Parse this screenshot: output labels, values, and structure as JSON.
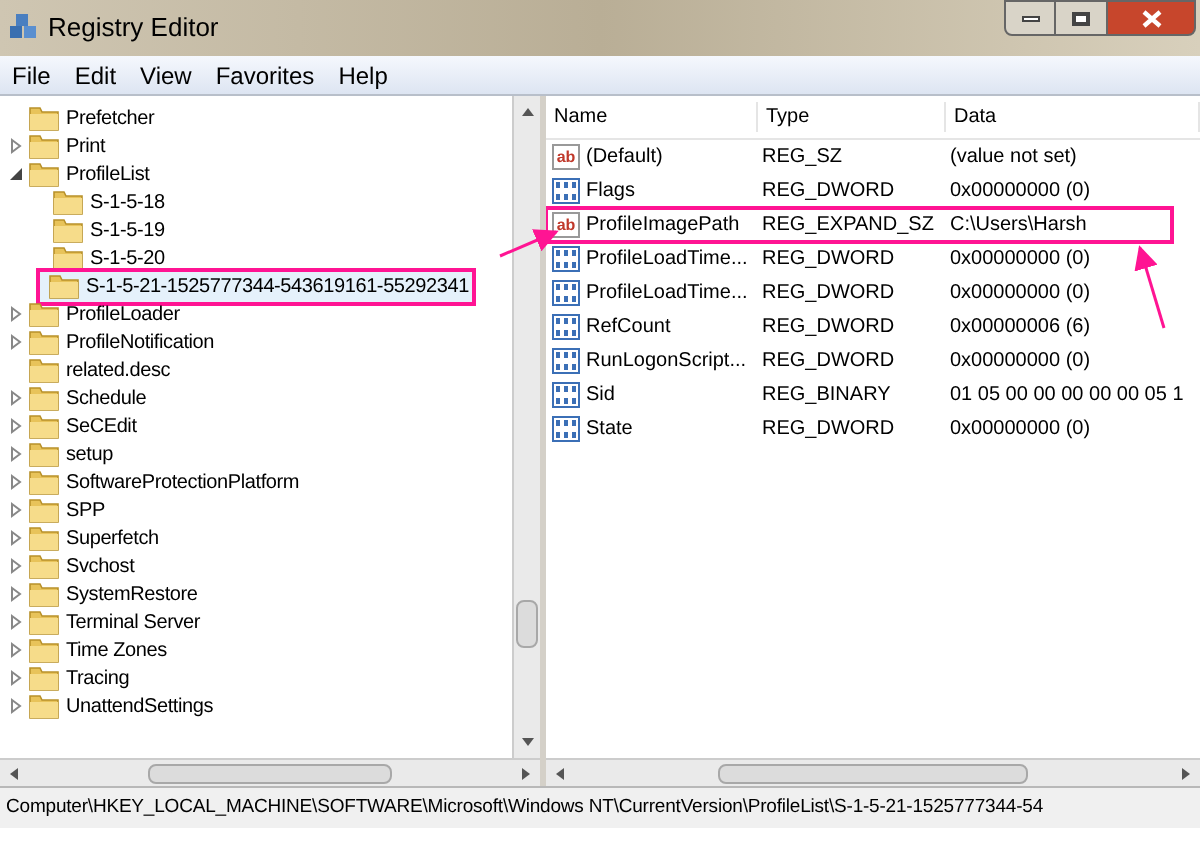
{
  "window": {
    "title": "Registry Editor"
  },
  "menu": [
    "File",
    "Edit",
    "View",
    "Favorites",
    "Help"
  ],
  "tree": [
    {
      "label": "Prefetcher",
      "selected": false
    },
    {
      "label": "Print",
      "expanded": false,
      "selected": false
    },
    {
      "label": "ProfileList",
      "expanded": true,
      "selected": false,
      "children": [
        {
          "label": "S-1-5-18",
          "selected": false
        },
        {
          "label": "S-1-5-19",
          "selected": false
        },
        {
          "label": "S-1-5-20",
          "selected": false
        },
        {
          "label": "S-1-5-21-1525777344-543619161-55292341",
          "selected": true
        }
      ]
    },
    {
      "label": "ProfileLoader",
      "expanded": false,
      "selected": false
    },
    {
      "label": "ProfileNotification",
      "expanded": false,
      "selected": false
    },
    {
      "label": "related.desc",
      "selected": false
    },
    {
      "label": "Schedule",
      "expanded": false,
      "selected": false
    },
    {
      "label": "SeCEdit",
      "expanded": false,
      "selected": false
    },
    {
      "label": "setup",
      "expanded": false,
      "selected": false
    },
    {
      "label": "SoftwareProtectionPlatform",
      "expanded": false,
      "selected": false
    },
    {
      "label": "SPP",
      "expanded": false,
      "selected": false
    },
    {
      "label": "Superfetch",
      "expanded": false,
      "selected": false
    },
    {
      "label": "Svchost",
      "expanded": false,
      "selected": false
    },
    {
      "label": "SystemRestore",
      "expanded": false,
      "selected": false
    },
    {
      "label": "Terminal Server",
      "expanded": false,
      "selected": false
    },
    {
      "label": "Time Zones",
      "expanded": false,
      "selected": false
    },
    {
      "label": "Tracing",
      "expanded": false,
      "selected": false
    },
    {
      "label": "UnattendSettings",
      "expanded": false,
      "selected": false
    }
  ],
  "values": {
    "columns": [
      "Name",
      "Type",
      "Data"
    ],
    "rows": [
      {
        "kind": "string",
        "icon_label": "ab",
        "name": "(Default)",
        "type": "REG_SZ",
        "data": "(value not set)",
        "highlighted": false
      },
      {
        "kind": "number",
        "name": "Flags",
        "type": "REG_DWORD",
        "data": "0x00000000 (0)",
        "highlighted": false
      },
      {
        "kind": "string",
        "icon_label": "ab",
        "name": "ProfileImagePath",
        "type": "REG_EXPAND_SZ",
        "data": "C:\\Users\\Harsh",
        "highlighted": true
      },
      {
        "kind": "number",
        "name": "ProfileLoadTime...",
        "type": "REG_DWORD",
        "data": "0x00000000 (0)",
        "highlighted": false
      },
      {
        "kind": "number",
        "name": "ProfileLoadTime...",
        "type": "REG_DWORD",
        "data": "0x00000000 (0)",
        "highlighted": false
      },
      {
        "kind": "number",
        "name": "RefCount",
        "type": "REG_DWORD",
        "data": "0x00000006 (6)",
        "highlighted": false
      },
      {
        "kind": "number",
        "name": "RunLogonScript...",
        "type": "REG_DWORD",
        "data": "0x00000000 (0)",
        "highlighted": false
      },
      {
        "kind": "number",
        "name": "Sid",
        "type": "REG_BINARY",
        "data": "01 05 00 00 00 00 00 05 1",
        "highlighted": false
      },
      {
        "kind": "number",
        "name": "State",
        "type": "REG_DWORD",
        "data": "0x00000000 (0)",
        "highlighted": false
      }
    ]
  },
  "status_bar": "Computer\\HKEY_LOCAL_MACHINE\\SOFTWARE\\Microsoft\\Windows NT\\CurrentVersion\\ProfileList\\S-1-5-21-1525777344-54"
}
